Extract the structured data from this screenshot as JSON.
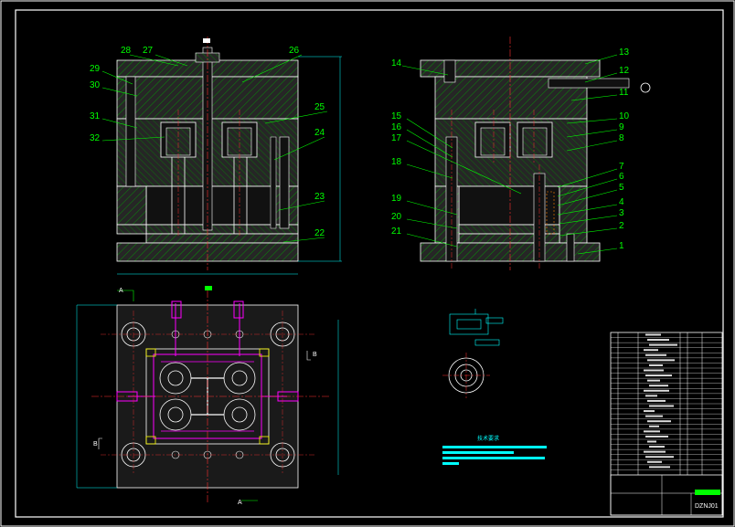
{
  "drawing": {
    "drawing_number": "DZNJ01",
    "colors": {
      "background": "#000000",
      "frame": "#ffffff",
      "part_fill": "#2b2b2b",
      "hatch": "#00ff00",
      "dimension": "#00ffff",
      "centerline": "#ff3030",
      "hidden": "#ff00ff",
      "leader": "#00ff00",
      "cooling": "#ffff00"
    }
  },
  "front_view": {
    "balloons": [
      "28",
      "27",
      "26",
      "29",
      "30",
      "25",
      "31",
      "32",
      "24",
      "23",
      "22"
    ]
  },
  "side_view": {
    "balloons": [
      "14",
      "13",
      "12",
      "15",
      "16",
      "11",
      "17",
      "10",
      "9",
      "8",
      "18",
      "7",
      "6",
      "5",
      "19",
      "4",
      "3",
      "20",
      "2",
      "21",
      "1"
    ]
  },
  "plan_view": {
    "section_marks": [
      "A",
      "A",
      "B",
      "B"
    ]
  },
  "tech_note": {
    "title": "技术要求"
  },
  "title_block": {
    "rows": 28
  }
}
